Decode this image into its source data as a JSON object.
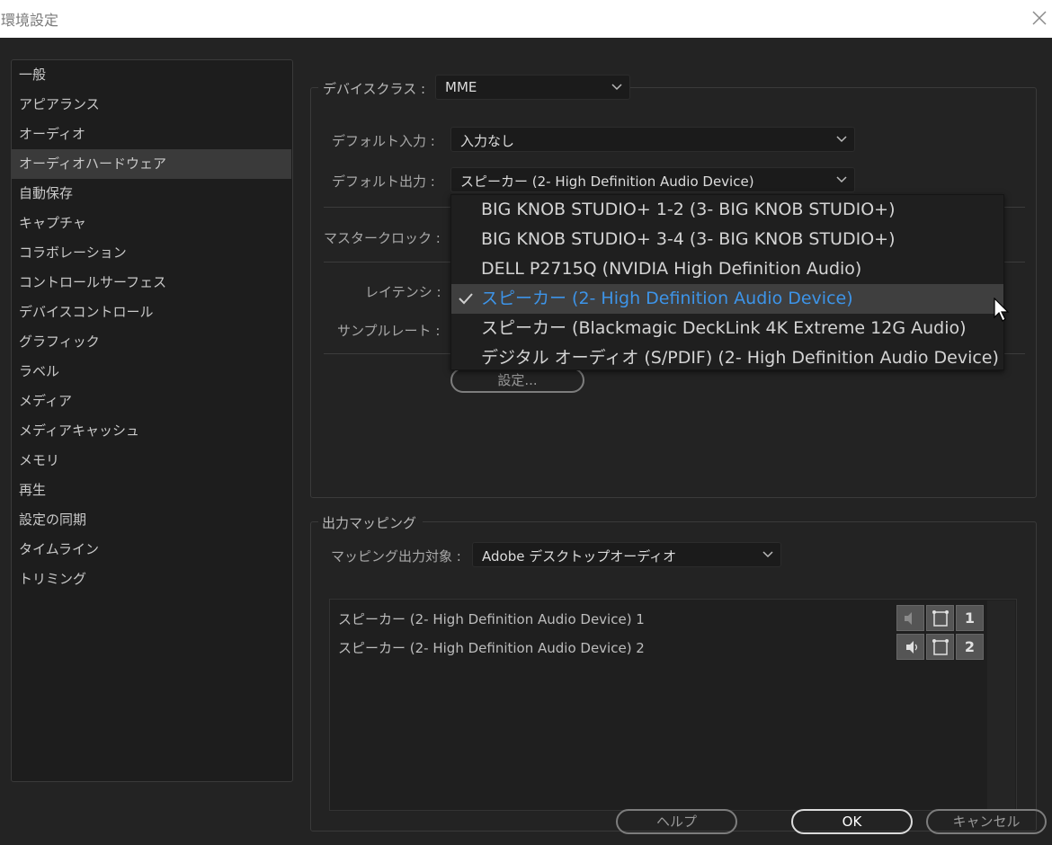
{
  "window": {
    "title": "環境設定"
  },
  "sidebar": {
    "items": [
      {
        "label": "一般"
      },
      {
        "label": "アピアランス"
      },
      {
        "label": "オーディオ"
      },
      {
        "label": "オーディオハードウェア"
      },
      {
        "label": "自動保存"
      },
      {
        "label": "キャプチャ"
      },
      {
        "label": "コラボレーション"
      },
      {
        "label": "コントロールサーフェス"
      },
      {
        "label": "デバイスコントロール"
      },
      {
        "label": "グラフィック"
      },
      {
        "label": "ラベル"
      },
      {
        "label": "メディア"
      },
      {
        "label": "メディアキャッシュ"
      },
      {
        "label": "メモリ"
      },
      {
        "label": "再生"
      },
      {
        "label": "設定の同期"
      },
      {
        "label": "タイムライン"
      },
      {
        "label": "トリミング"
      }
    ],
    "selected": "オーディオハードウェア"
  },
  "device": {
    "class_label": "デバイスクラス :",
    "class_value": "MME",
    "input_label": "デフォルト入力 :",
    "input_value": "入力なし",
    "output_label": "デフォルト出力 :",
    "output_value": "スピーカー (2- High Definition Audio Device)",
    "clock_label": "マスタークロック :",
    "latency_label": "レイテンシ :",
    "samplerate_label": "サンプルレート :",
    "settings_button": "設定..."
  },
  "output_menu": {
    "items": [
      {
        "label": "BIG KNOB STUDIO+ 1-2 (3- BIG KNOB STUDIO+)"
      },
      {
        "label": "BIG KNOB STUDIO+ 3-4 (3- BIG KNOB STUDIO+)"
      },
      {
        "label": "DELL P2715Q (NVIDIA High Definition Audio)"
      },
      {
        "label": "スピーカー (2- High Definition Audio Device)"
      },
      {
        "label": "スピーカー (Blackmagic DeckLink 4K Extreme 12G Audio)"
      },
      {
        "label": "デジタル オーディオ (S/PDIF) (2- High Definition Audio Device)"
      }
    ],
    "selected": "スピーカー (2- High Definition Audio Device)",
    "highlight_color": "#3d94e8"
  },
  "mapping": {
    "section_label": "出力マッピング",
    "target_label": "マッピング出力対象 :",
    "target_value": "Adobe デスクトップオーディオ",
    "channels": [
      {
        "label": "スピーカー (2- High Definition Audio Device) 1",
        "number": "1"
      },
      {
        "label": "スピーカー (2- High Definition Audio Device) 2",
        "number": "2"
      }
    ]
  },
  "footer": {
    "help": "ヘルプ",
    "ok": "OK",
    "cancel": "キャンセル"
  }
}
